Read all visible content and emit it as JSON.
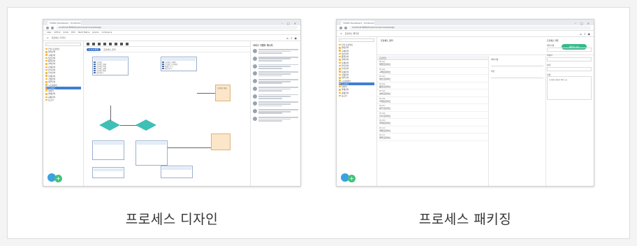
{
  "captions": {
    "left": "프로세스 디자인",
    "right": "프로세스 패키징"
  },
  "browser": {
    "tab_title": "TOSEC Dashboard - ProStudio",
    "url": "localhost:8080/tosec/nav/process/design",
    "bookmarks": [
      "Apps",
      "GitHub",
      "Gmail",
      "DOC",
      "React Native",
      "Jenkins",
      "Confluence"
    ]
  },
  "left_screen": {
    "breadcrumb": "프로세스 디자인",
    "canvas_title": "프로세스 관리",
    "canvas_pill": "1.0.0 버전",
    "sidebar_items": [
      "전사 프로세스",
      "영업관리",
      "구매관리",
      "생산관리",
      "품질관리",
      "설비관리",
      "자재관리",
      "원가관리",
      "인사관리",
      "회계관리",
      "경영관리",
      "재무관리",
      "시스템관리",
      "프로세스",
      "데이터",
      "결재관리",
      "공통관리",
      "보고서"
    ],
    "selected_index": 13,
    "panel_title": "서비스 이벤트 메시지",
    "node_a": [
      "프로세스",
      "프로세스 정의",
      "프로세스 버전",
      "프로세스 설계",
      "프로세스 배포",
      "실행 관리"
    ],
    "node_b": [
      "프로세스 이벤트",
      "프로세스 모니터링",
      "이벤트 로그",
      "알림 관리"
    ],
    "box_right": "프로세스 배포"
  },
  "right_screen": {
    "breadcrumb": "프로세스 패키징",
    "package_title": "프로세스 관리",
    "action_button": "패키징 시작",
    "list_header": "프로세스",
    "list_items": [
      {
        "code": "PR-001",
        "name": "영업프로세스"
      },
      {
        "code": "PR-002",
        "name": "구매프로세스"
      },
      {
        "code": "PR-003",
        "name": "생산프로세스"
      },
      {
        "code": "PR-004",
        "name": "품질프로세스"
      },
      {
        "code": "PR-005",
        "name": "설비프로세스"
      },
      {
        "code": "PR-006",
        "name": "자재프로세스"
      },
      {
        "code": "PR-007",
        "name": "원가프로세스"
      },
      {
        "code": "PR-008",
        "name": "인사프로세스"
      },
      {
        "code": "PR-009",
        "name": "회계프로세스"
      },
      {
        "code": "PR-010",
        "name": "경영프로세스"
      },
      {
        "code": "PR-011",
        "name": "재무프로세스"
      }
    ],
    "mid_labels": [
      "패키지명",
      "버전"
    ],
    "right_title": "프로세스 작업",
    "right_labels": [
      "패키지명",
      "작성자",
      "상태",
      "설명"
    ],
    "note": "프로세스 패키지 작업 노트"
  },
  "colors": {
    "accent": "#3f7fd3",
    "green": "#39b98a",
    "teal": "#3fc0b6"
  }
}
